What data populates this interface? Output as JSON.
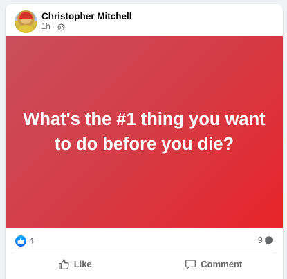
{
  "post": {
    "author": "Christopher Mitchell",
    "time": "1h",
    "separator": "·",
    "audience_icon": "globe-icon",
    "text": "What's the #1 thing you want to do before you die?",
    "banner_colors": [
      "#c94f5c",
      "#e8242a"
    ]
  },
  "stats": {
    "reaction_icon": "like-reaction-icon",
    "reaction_count": "4",
    "comment_count": "9",
    "comment_icon": "comment-bubble-icon"
  },
  "actions": {
    "like_label": "Like",
    "comment_label": "Comment"
  },
  "colors": {
    "accent": "#0866ff",
    "secondary_text": "#65676b",
    "primary_text": "#050505"
  }
}
